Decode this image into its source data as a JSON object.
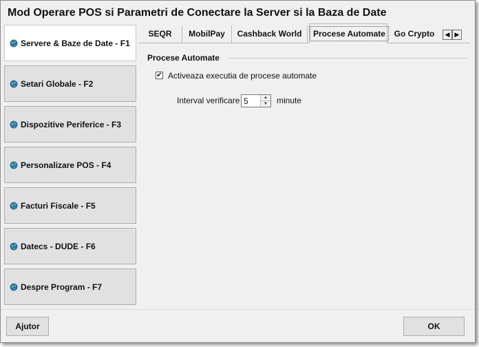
{
  "window": {
    "title": "Mod Operare POS si Parametri de Conectare la Server si la Baza de Date"
  },
  "sidebar": {
    "items": [
      {
        "label": "Servere & Baze de Date - F1",
        "icon": "globe-icon",
        "active": true
      },
      {
        "label": "Setari Globale - F2",
        "icon": "globe-icon"
      },
      {
        "label": "Dispozitive Periferice - F3",
        "icon": "globe-icon"
      },
      {
        "label": "Personalizare POS - F4",
        "icon": "globe-icon"
      },
      {
        "label": "Facturi Fiscale - F5",
        "icon": "globe-icon"
      },
      {
        "label": "Datecs - DUDE - F6",
        "icon": "globe-icon"
      },
      {
        "label": "Despre Program - F7",
        "icon": "globe-icon"
      }
    ]
  },
  "tabs": {
    "items": [
      {
        "label": "SEQR"
      },
      {
        "label": "MobilPay"
      },
      {
        "label": "Cashback World"
      },
      {
        "label": "Procese Automate",
        "selected": true
      },
      {
        "label": "Go Crypto"
      }
    ],
    "scroll_left": "◀",
    "scroll_right": "▶"
  },
  "panel": {
    "group_title": "Procese Automate",
    "checkbox_label": "Activeaza executia de procese automate",
    "checkbox_checked": true,
    "checkbox_mark": "✔",
    "interval_label": "Interval verificare",
    "interval_value": "5",
    "interval_unit": "minute",
    "spin_up": "▲",
    "spin_down": "▼"
  },
  "footer": {
    "help_label": "Ajutor",
    "ok_label": "OK"
  },
  "colors": {
    "window_bg": "#f0f0f0",
    "button_bg": "#e1e1e1",
    "active_item_bg": "#ffffff",
    "globe_blue": "#2a6fb5"
  }
}
